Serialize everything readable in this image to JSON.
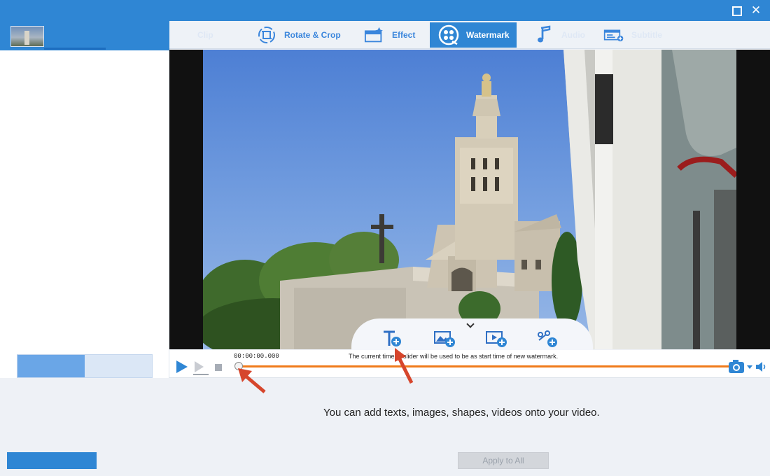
{
  "window": {
    "close_glyph": "✕"
  },
  "tabs": [
    {
      "label": "Clip",
      "icon": "scissors-icon",
      "faint": true
    },
    {
      "label": "Rotate & Crop",
      "icon": "rotate-crop-icon"
    },
    {
      "label": "Effect",
      "icon": "effect-icon"
    },
    {
      "label": "Watermark",
      "icon": "watermark-icon",
      "active": true
    },
    {
      "label": "Audio",
      "icon": "music-note-icon",
      "faint": true
    },
    {
      "label": "Subtitle",
      "icon": "subtitle-icon",
      "faint": true
    }
  ],
  "watermark_tools": [
    {
      "icon": "add-text-icon"
    },
    {
      "icon": "add-image-icon"
    },
    {
      "icon": "add-video-icon"
    },
    {
      "icon": "add-shape-icon"
    }
  ],
  "player": {
    "time": "00:00:00.000",
    "hint": "The current time of slider will be used to be as start time of new watermark.",
    "slider_position": 0
  },
  "main": {
    "caption": "You can add texts, images, shapes, videos onto your video."
  },
  "footer": {
    "apply_label": "Apply to All"
  },
  "colors": {
    "accent": "#2f86d4",
    "track": "#f07a1a",
    "annotation_arrow": "#d6462c"
  }
}
